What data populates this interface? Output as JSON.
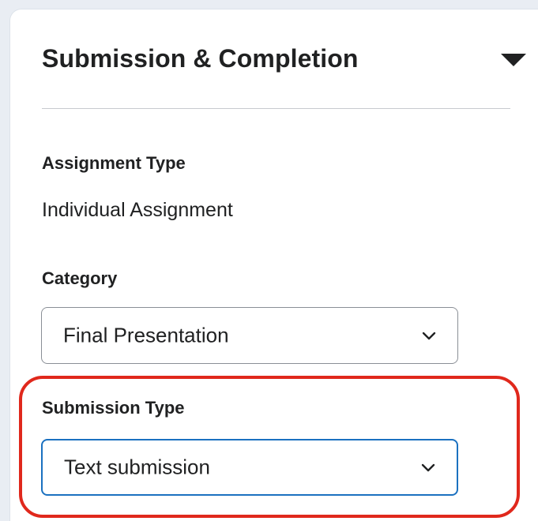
{
  "section": {
    "title": "Submission & Completion",
    "collapse_icon": "triangle-down-icon"
  },
  "assignment_type": {
    "label": "Assignment Type",
    "value": "Individual Assignment"
  },
  "category": {
    "label": "Category",
    "selected": "Final Presentation",
    "chevron_icon": "chevron-down-icon"
  },
  "submission_type": {
    "label": "Submission Type",
    "selected": "Text submission",
    "chevron_icon": "chevron-down-icon"
  },
  "colors": {
    "highlight": "#e0281c",
    "focus_border": "#1b71c0",
    "text": "#202122"
  }
}
